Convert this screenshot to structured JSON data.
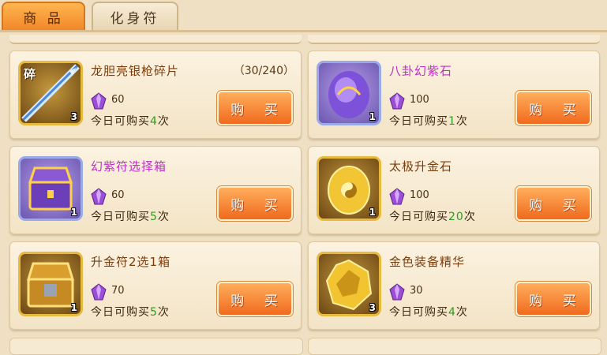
{
  "tabs": [
    {
      "label": "商 品",
      "active": true
    },
    {
      "label": "化身符",
      "active": false
    }
  ],
  "currency_icon": "purple-crystal-icon",
  "colors": {
    "daily_number": "#2e9a1f",
    "purple_name": "#c02fc8",
    "gold_name": "#7a3d0d",
    "buy_button": "#f06a1e"
  },
  "items": [
    {
      "name": "龙胆亮银枪碎片",
      "limit": "（30/240）",
      "tag": "碎",
      "count": "3",
      "price": "60",
      "daily_prefix": "今日可购买",
      "daily_num": "4",
      "daily_suffix": "次",
      "buy_label": "购 买",
      "icon": "spear-fragment-icon"
    },
    {
      "name": "八卦幻紫石",
      "count": "1",
      "price": "100",
      "daily_prefix": "今日可购买",
      "daily_num": "1",
      "daily_suffix": "次",
      "buy_label": "购 买",
      "icon": "purple-bagua-stone-icon"
    },
    {
      "name": "幻紫符选择箱",
      "count": "1",
      "price": "60",
      "daily_prefix": "今日可购买",
      "daily_num": "5",
      "daily_suffix": "次",
      "buy_label": "购 买",
      "icon": "purple-chest-icon"
    },
    {
      "name": "太极升金石",
      "count": "1",
      "price": "100",
      "daily_prefix": "今日可购买",
      "daily_num": "20",
      "daily_suffix": "次",
      "buy_label": "购 买",
      "icon": "gold-taiji-stone-icon"
    },
    {
      "name": "升金符2选1箱",
      "count": "1",
      "price": "70",
      "daily_prefix": "今日可购买",
      "daily_num": "5",
      "daily_suffix": "次",
      "buy_label": "购 买",
      "icon": "gold-chest-icon"
    },
    {
      "name": "金色装备精华",
      "count": "3",
      "price": "30",
      "daily_prefix": "今日可购买",
      "daily_num": "4",
      "daily_suffix": "次",
      "buy_label": "购 买",
      "icon": "gold-essence-icon"
    }
  ]
}
